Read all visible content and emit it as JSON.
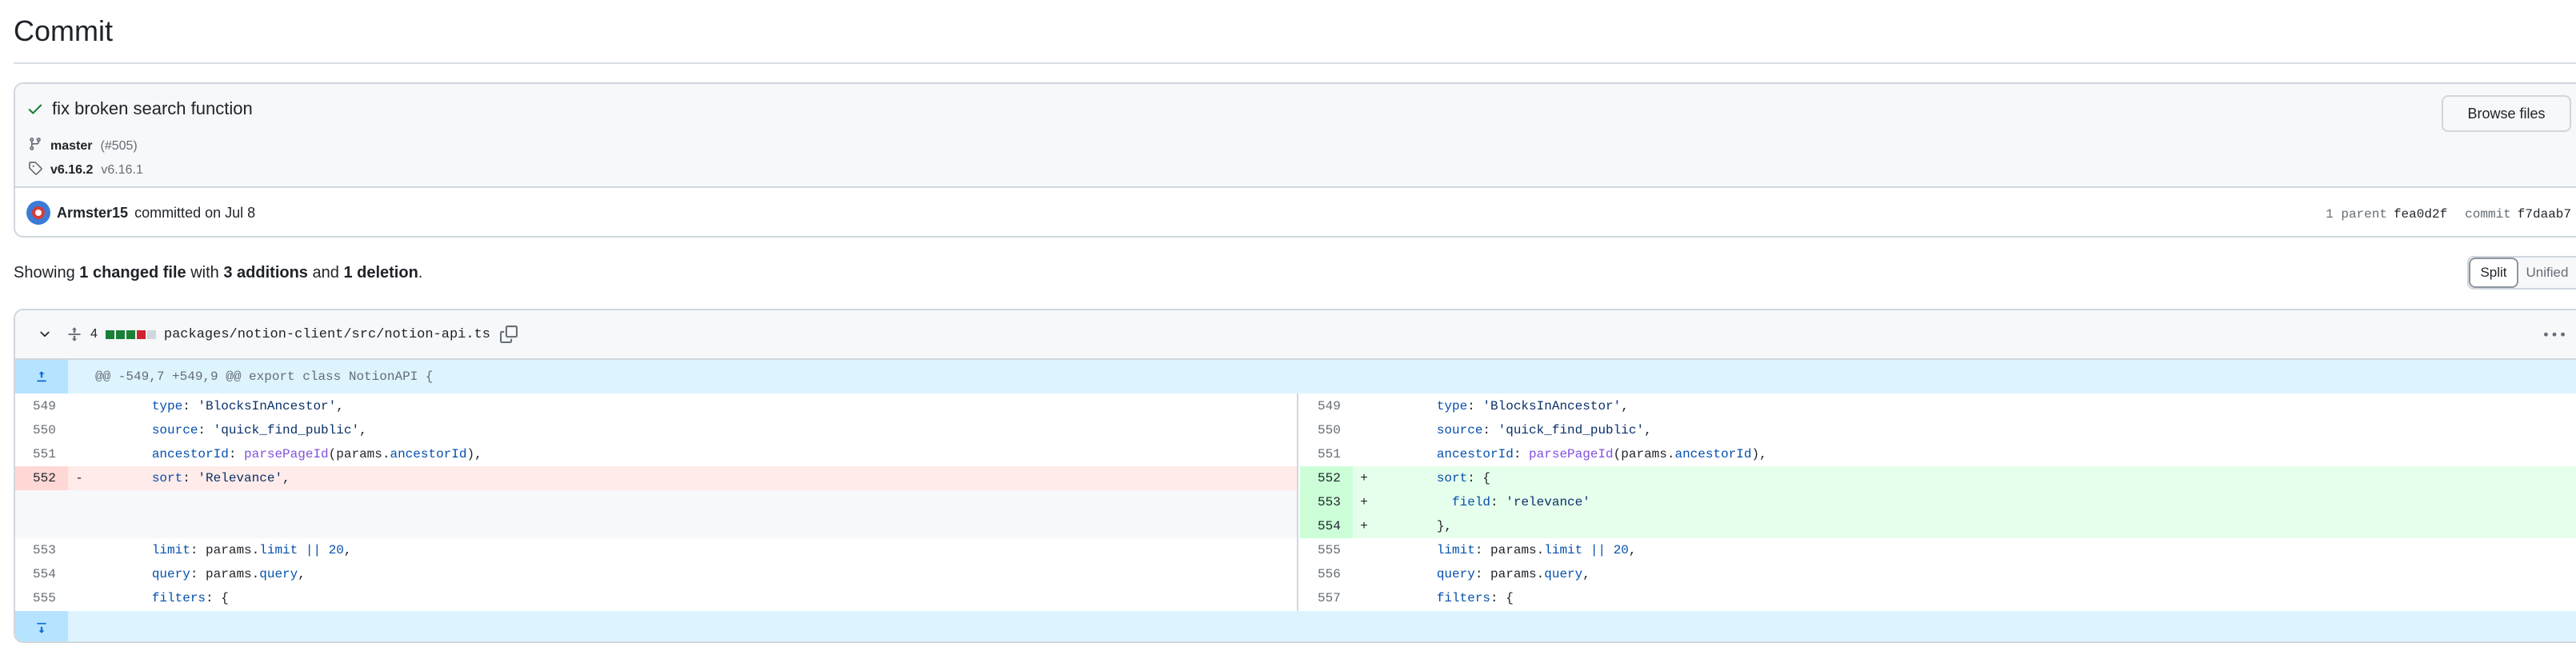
{
  "page": {
    "title": "Commit"
  },
  "commit": {
    "title": "fix broken search function",
    "branch": "master",
    "pr": "(#505)",
    "tag_primary": "v6.16.2",
    "tag_secondary": "v6.16.1",
    "browse_label": "Browse files",
    "author": "Armster15",
    "committed_text": "committed on Jul 8",
    "parent_label": "1 parent",
    "parent_sha": "fea0d2f",
    "commit_label": "commit",
    "commit_sha": "f7daab7"
  },
  "summary": {
    "showing": "Showing",
    "changed": "1 changed file",
    "with": "with",
    "additions": "3 additions",
    "and": "and",
    "deletions": "1 deletion",
    "period": "."
  },
  "view_toggle": {
    "split": "Split",
    "unified": "Unified"
  },
  "file": {
    "change_count": "4",
    "path": "packages/notion-client/src/notion-api.ts",
    "diffstat": [
      "#1a7f37",
      "#1a7f37",
      "#1a7f37",
      "#cf222e",
      "#d0d7de"
    ],
    "hunk_header": "@@ -549,7 +549,9 @@ export class NotionAPI {"
  },
  "diff": {
    "left": [
      {
        "n": "549",
        "m": "",
        "t": "        type: 'BlocksInAncestor',",
        "kind": "ctx"
      },
      {
        "n": "550",
        "m": "",
        "t": "        source: 'quick_find_public',",
        "kind": "ctx"
      },
      {
        "n": "551",
        "m": "",
        "t": "        ancestorId: parsePageId(params.ancestorId),",
        "kind": "ctx"
      },
      {
        "n": "552",
        "m": "-",
        "t": "        sort: 'Relevance',",
        "kind": "del"
      },
      {
        "n": "",
        "m": "",
        "t": "",
        "kind": "empty"
      },
      {
        "n": "",
        "m": "",
        "t": "",
        "kind": "empty"
      },
      {
        "n": "553",
        "m": "",
        "t": "        limit: params.limit || 20,",
        "kind": "ctx"
      },
      {
        "n": "554",
        "m": "",
        "t": "        query: params.query,",
        "kind": "ctx"
      },
      {
        "n": "555",
        "m": "",
        "t": "        filters: {",
        "kind": "ctx"
      }
    ],
    "right": [
      {
        "n": "549",
        "m": "",
        "t": "        type: 'BlocksInAncestor',",
        "kind": "ctx"
      },
      {
        "n": "550",
        "m": "",
        "t": "        source: 'quick_find_public',",
        "kind": "ctx"
      },
      {
        "n": "551",
        "m": "",
        "t": "        ancestorId: parsePageId(params.ancestorId),",
        "kind": "ctx"
      },
      {
        "n": "552",
        "m": "+",
        "t": "        sort: {",
        "kind": "add"
      },
      {
        "n": "553",
        "m": "+",
        "t": "          field: 'relevance'",
        "kind": "add"
      },
      {
        "n": "554",
        "m": "+",
        "t": "        },",
        "kind": "add"
      },
      {
        "n": "555",
        "m": "",
        "t": "        limit: params.limit || 20,",
        "kind": "ctx"
      },
      {
        "n": "556",
        "m": "",
        "t": "        query: params.query,",
        "kind": "ctx"
      },
      {
        "n": "557",
        "m": "",
        "t": "        filters: {",
        "kind": "ctx"
      }
    ]
  }
}
